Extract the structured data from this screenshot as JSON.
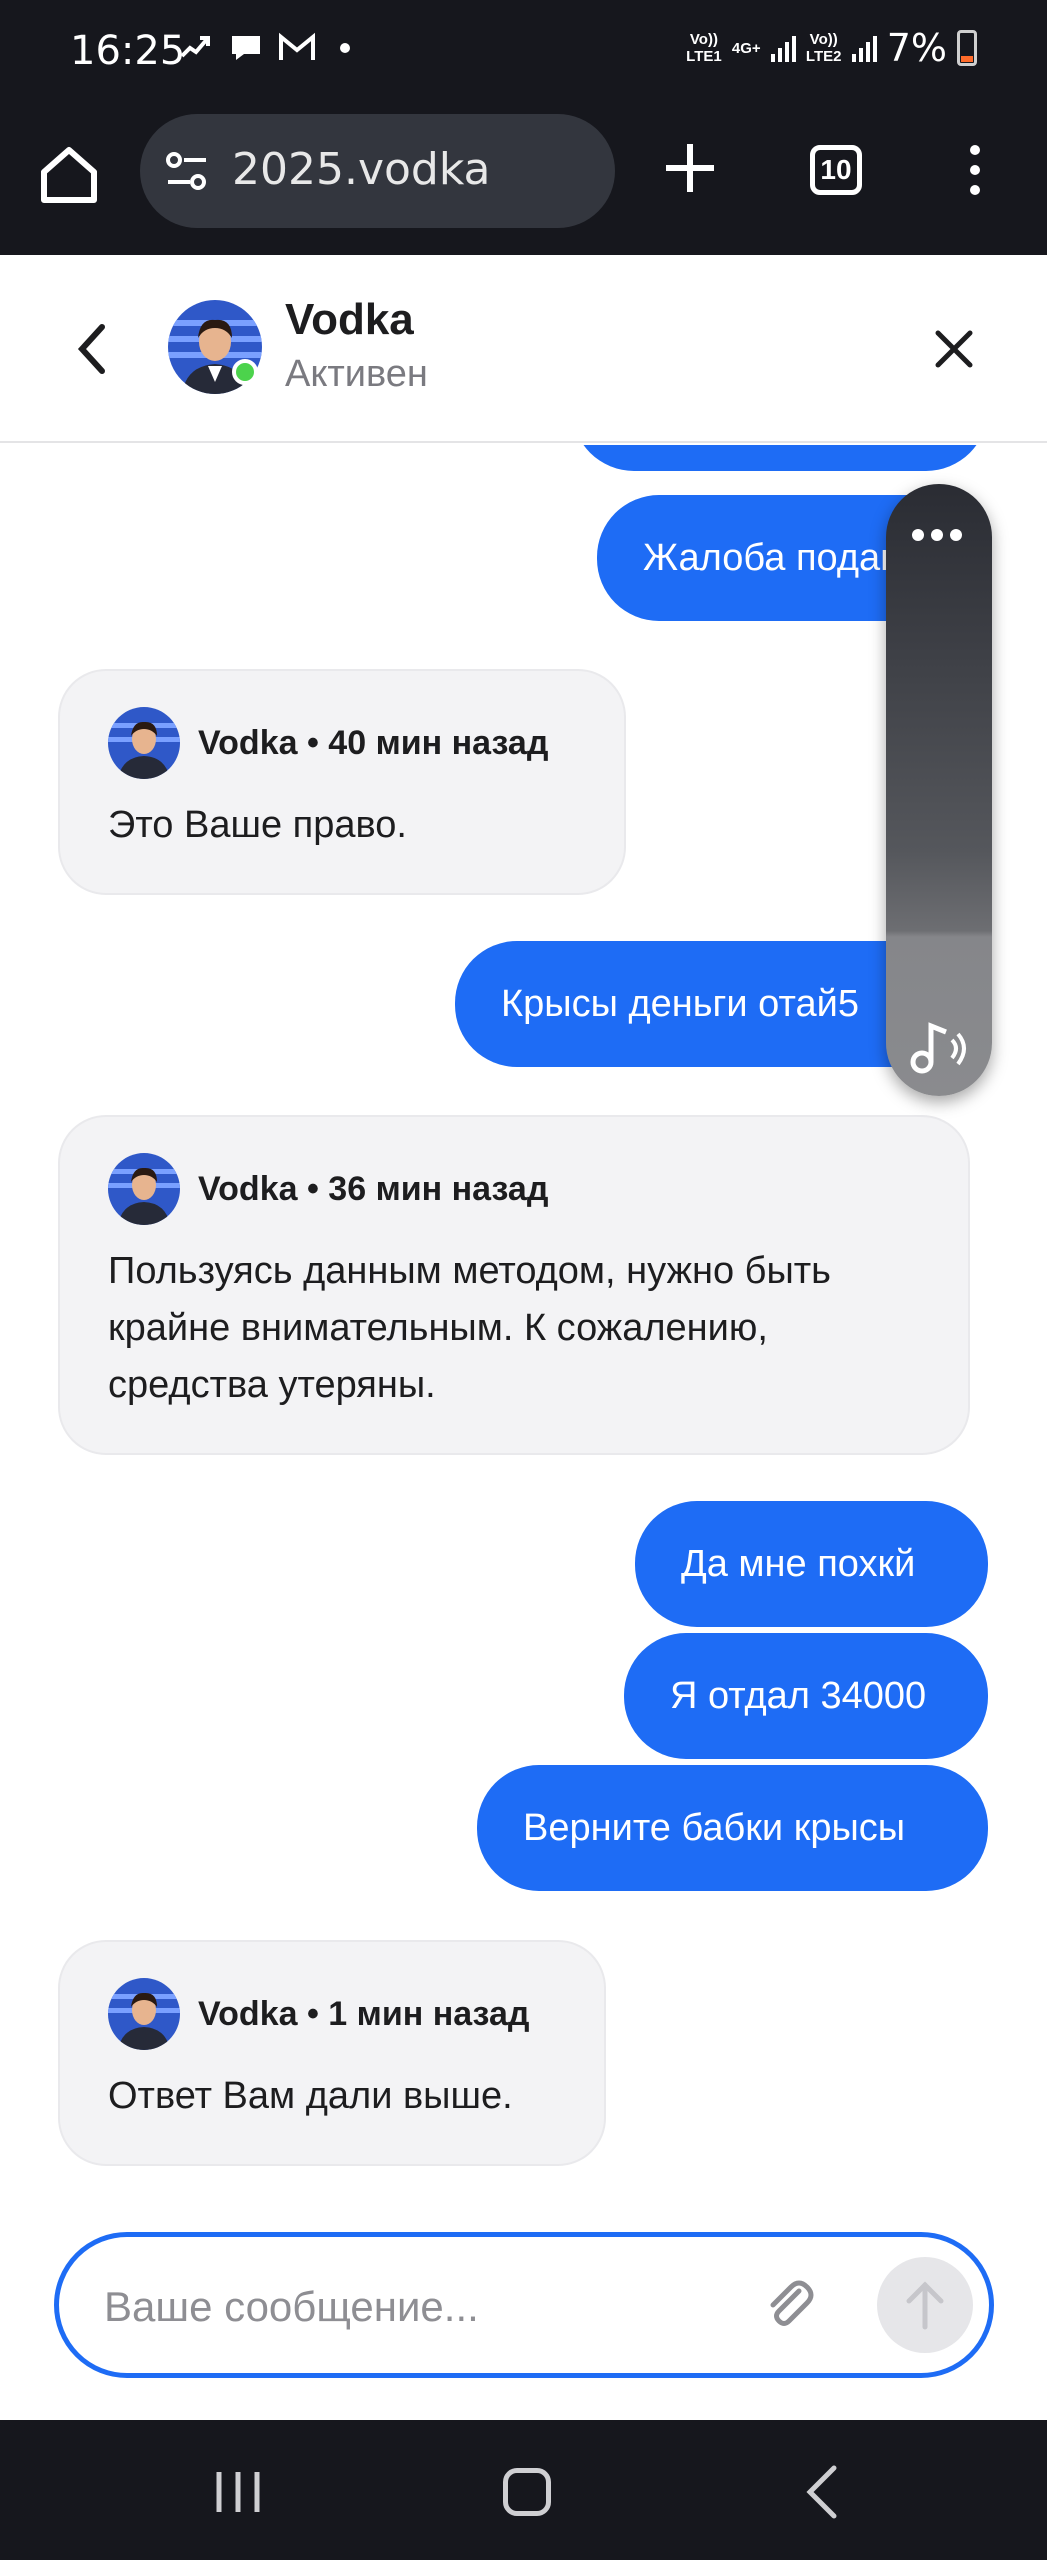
{
  "status_bar": {
    "time": "16:25",
    "sim1": "Vo)) LTE1",
    "sim1_type": "4G+",
    "sim2": "Vo)) LTE2",
    "battery": "7%",
    "battery_color": "#ff6b2a"
  },
  "browser": {
    "url": "2025.vodka",
    "tab_count": "10",
    "icons": [
      "home-icon",
      "tune-icon",
      "plus-icon",
      "tabs-icon",
      "more-vert-icon"
    ]
  },
  "chat_header": {
    "name": "Vodka",
    "status": "Активен",
    "online_color": "#4cd34c"
  },
  "messages": {
    "out_partial": "",
    "out_complaint": "Жалоба подана",
    "in1": {
      "meta": "Vodka • 40 мин назад",
      "text": "Это Ваше право."
    },
    "out_rats": "Крысы деньги отай5",
    "in2": {
      "meta": "Vodka • 36 мин назад",
      "text": "Пользуясь данным методом, нужно быть крайне внимательным. К сожалению, средства утеряны."
    },
    "out_1": "Да мне похкй",
    "out_2": "Я отдал 34000",
    "out_3": "Верните бабки крысы",
    "in3": {
      "meta": "Vodka • 1 мин назад",
      "text": "Ответ Вам дали выше."
    }
  },
  "input": {
    "placeholder": "Ваше сообщение...",
    "value": ""
  },
  "colors": {
    "accent": "#1e6cf5",
    "incoming_bg": "#f3f3f5",
    "system_bar": "#16171d"
  }
}
